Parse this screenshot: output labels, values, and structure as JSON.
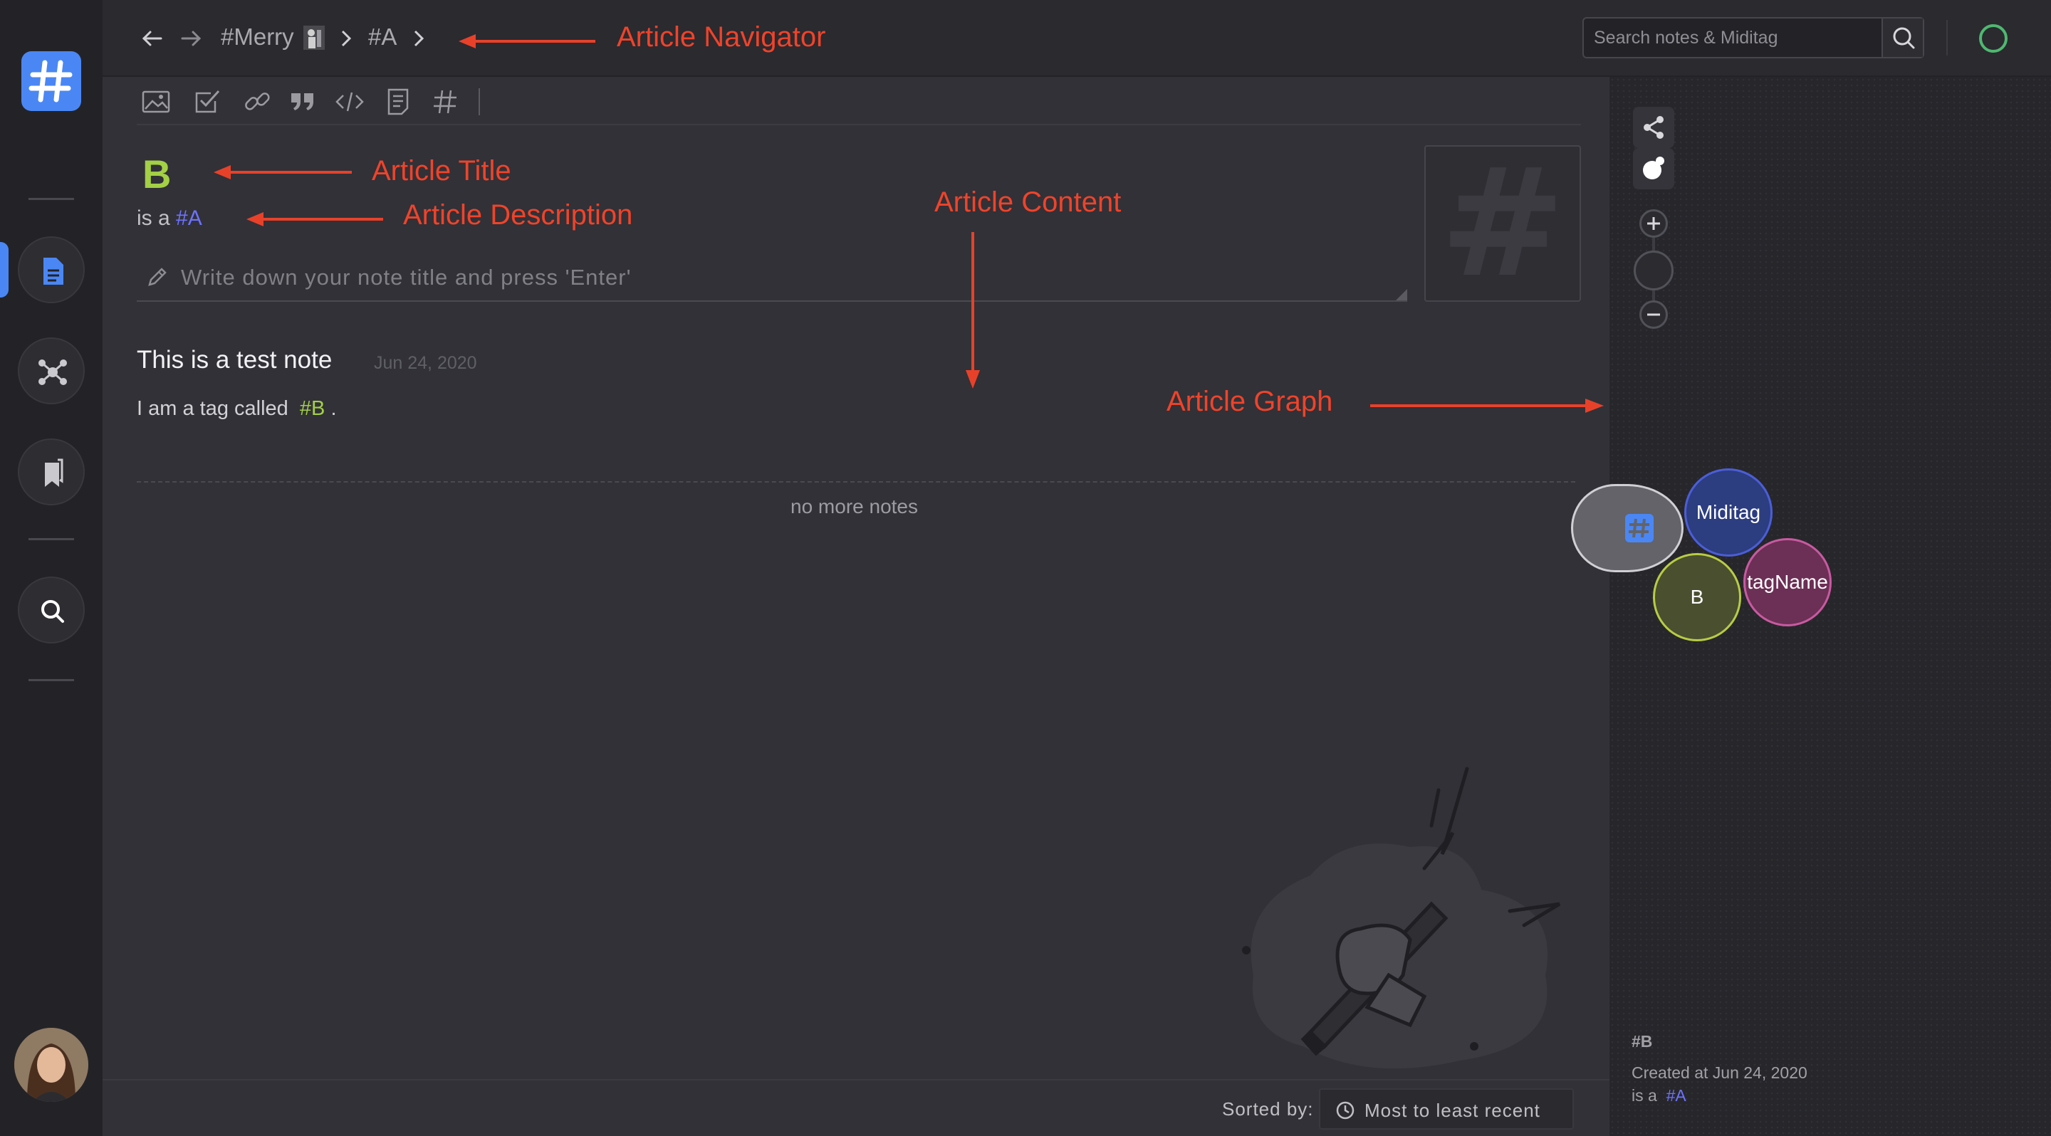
{
  "nav": {
    "crumbs": [
      "#Merry",
      "#A"
    ],
    "back": "←",
    "forward": "→"
  },
  "search": {
    "placeholder": "Search notes & Miditag"
  },
  "article": {
    "title": "B",
    "desc_prefix": "is a",
    "desc_tag": "#A",
    "input_placeholder": "Write down your note title and press 'Enter'",
    "thumb_glyph": "#"
  },
  "note": {
    "title": "This is a test note",
    "date": "Jun 24, 2020",
    "body_prefix": "I am a tag called",
    "body_tag": "#B",
    "body_suffix": "."
  },
  "list": {
    "end_text": "no more notes"
  },
  "sort": {
    "label": "Sorted by:",
    "value": "Most to least recent"
  },
  "graph": {
    "nodes": [
      "Miditag",
      "tagName",
      "B"
    ],
    "info_title": "#B",
    "info_created": "Created at Jun 24, 2020",
    "info_isa_prefix": "is a",
    "info_isa_tag": "#A"
  },
  "annotations": {
    "navigator": "Article Navigator",
    "title": "Article Title",
    "description": "Article Description",
    "content": "Article Content",
    "graph": "Article Graph"
  },
  "colors": {
    "accent": "#4a87f4",
    "title_green": "#a3d045",
    "tag_blue": "#6e73ff",
    "annotation_red": "#f0432a",
    "status_green": "#4fb870"
  }
}
